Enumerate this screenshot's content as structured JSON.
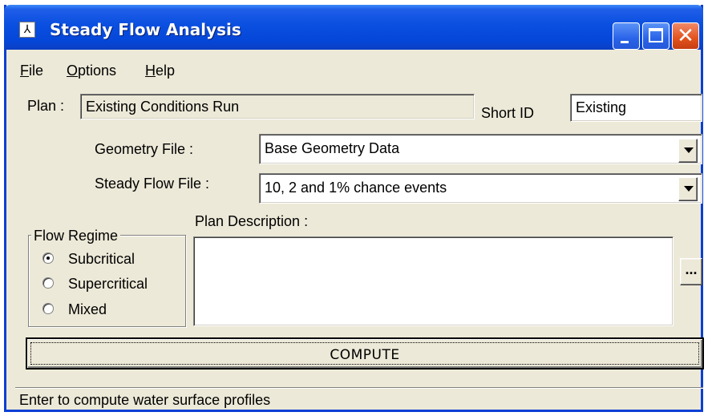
{
  "window": {
    "title": "Steady Flow Analysis",
    "icon": "hec-ras-app-icon",
    "controls": {
      "minimize": "minimize-icon",
      "maximize": "maximize-icon",
      "close": "✕"
    }
  },
  "menu": {
    "items": [
      "File",
      "Options",
      "Help"
    ]
  },
  "plan": {
    "label": "Plan :",
    "value": "Existing Conditions Run",
    "short_id_label": "Short ID",
    "short_id_value": "Existing"
  },
  "geometry": {
    "label": "Geometry File :",
    "selected": "Base Geometry Data"
  },
  "steady_flow": {
    "label": "Steady Flow File :",
    "selected": "10, 2 and 1% chance events"
  },
  "flow_regime": {
    "title": "Flow Regime",
    "options": [
      {
        "label": "Subcritical",
        "checked": true
      },
      {
        "label": "Supercritical",
        "checked": false
      },
      {
        "label": "Mixed",
        "checked": false
      }
    ]
  },
  "description": {
    "label": "Plan Description :",
    "value": "",
    "ellipsis_label": "..."
  },
  "compute": {
    "label": "COMPUTE"
  },
  "status": {
    "text": "Enter to compute water surface profiles"
  },
  "colors": {
    "titlebar": "#0a4fe0",
    "window_bg": "#ece9d8",
    "close_button": "#e2521c"
  }
}
